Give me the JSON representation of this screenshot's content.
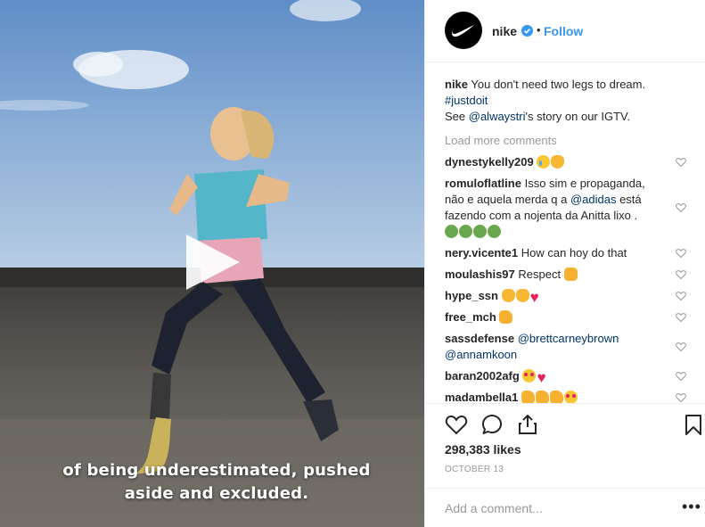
{
  "media": {
    "subtitle_line1": "of being underestimated, pushed",
    "subtitle_line2": "aside and excluded."
  },
  "header": {
    "username": "nike",
    "follow_label": "Follow",
    "separator": "•",
    "verified_icon": "verified-badge-icon",
    "accent_color": "#3897f0"
  },
  "caption": {
    "username": "nike",
    "text": "You don't need two legs to dream.",
    "hashtag": "#justdoit",
    "see_prefix": "See ",
    "mention": "@alwaystri",
    "see_suffix": "'s story on our IGTV."
  },
  "load_more": "Load more comments",
  "comments": [
    {
      "user": "dynestykelly209",
      "text": "",
      "emojis": [
        "crying-face",
        "clapping-hands"
      ]
    },
    {
      "user": "romuloflatline",
      "text": "Isso sim e propaganda, não e aquela merda q a ",
      "mention": "@adidas",
      "text_after": " está fazendo com a nojenta da Anitta lixo .",
      "emojis": [
        "nauseated-face",
        "nauseated-face",
        "nauseated-face",
        "nauseated-face"
      ]
    },
    {
      "user": "nery.vicente1",
      "text": "How can hoy do that",
      "emojis": []
    },
    {
      "user": "moulashis97",
      "text": "Respect",
      "emojis": [
        "raised-fist"
      ]
    },
    {
      "user": "hype_ssn",
      "text": "",
      "emojis": [
        "clapping-hands",
        "clapping-hands",
        "red-heart"
      ]
    },
    {
      "user": "free_mch",
      "text": "",
      "emojis": [
        "thumbs-up"
      ]
    },
    {
      "user": "sassdefense",
      "mention1": "@brettcarneybrown",
      "mention2": "@annamkoon",
      "emojis": []
    },
    {
      "user": "baran2002afg",
      "text": "",
      "emojis": [
        "star-struck",
        "red-heart"
      ]
    },
    {
      "user": "madambella1",
      "text": "",
      "emojis": [
        "thumbs-up",
        "thumbs-up",
        "thumbs-up",
        "star-struck"
      ]
    }
  ],
  "actions": {
    "likes": "298,383 likes",
    "date": "OCTOBER 13",
    "add_comment_placeholder": "Add a comment...",
    "more_label": "•••"
  }
}
